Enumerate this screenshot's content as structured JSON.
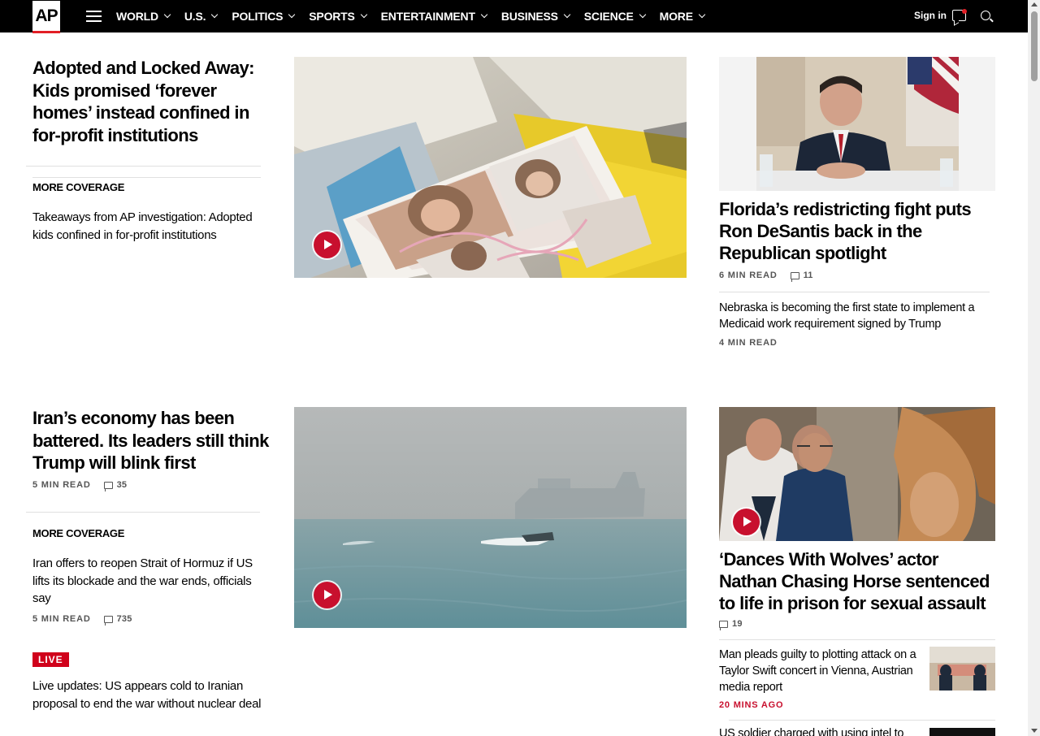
{
  "logo": {
    "text": "AP"
  },
  "nav": {
    "items": [
      {
        "label": "WORLD"
      },
      {
        "label": "U.S."
      },
      {
        "label": "POLITICS"
      },
      {
        "label": "SPORTS"
      },
      {
        "label": "ENTERTAINMENT"
      },
      {
        "label": "BUSINESS"
      },
      {
        "label": "SCIENCE"
      },
      {
        "label": "MORE"
      }
    ],
    "signin": "Sign in"
  },
  "colors": {
    "accent": "#c8102e",
    "nav_bg": "#000000"
  },
  "story1": {
    "headline": "Adopted and Locked Away: Kids promised ‘forever homes’ instead confined in for-profit institutions",
    "more_coverage": "MORE COVERAGE",
    "related": "Takeaways from AP investigation: Adopted kids confined in for-profit institutions"
  },
  "story2": {
    "headline": "Florida’s redistricting fight puts Ron DeSantis back in the Republican spotlight",
    "read_time": "6 MIN READ",
    "comments": "11",
    "related": "Nebraska is becoming the first state to implement a Medicaid work requirement signed by Trump",
    "related_read_time": "4 MIN READ"
  },
  "story3": {
    "headline": "Iran’s economy has been battered. Its leaders still think Trump will blink first",
    "read_time": "5 MIN READ",
    "comments": "35",
    "more_coverage": "MORE COVERAGE",
    "related": "Iran offers to reopen Strait of Hormuz if US lifts its blockade and the war ends, officials say",
    "related_read_time": "5 MIN READ",
    "related_comments": "735",
    "live_badge": "LIVE",
    "live": "Live updates: US appears cold to Iranian proposal to end the war without nuclear deal"
  },
  "story4": {
    "headline": "‘Dances With Wolves’ actor Nathan Chasing Horse sentenced to life in prison for sexual assault",
    "comments": "19",
    "related": "Man pleads guilty to plotting attack on a Taylor Swift concert in Vienna, Austrian media report",
    "related_time": "20 MINS AGO",
    "related2": "US soldier charged with using intel to"
  }
}
